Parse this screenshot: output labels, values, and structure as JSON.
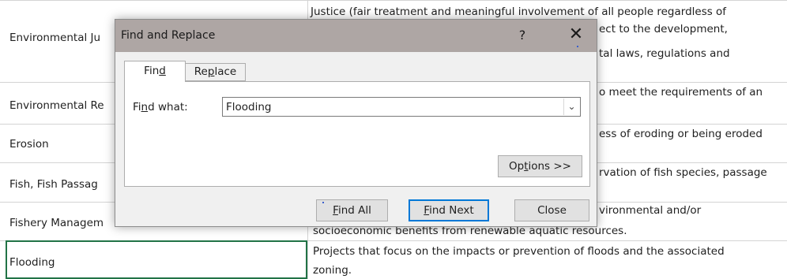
{
  "sheet": {
    "rows": [
      {
        "term": "Environmental Ju",
        "definition_lines": [
          "Justice (fair treatment and meaningful involvement of all people regardless of",
          "ect to the development,",
          "tal laws, regulations and"
        ]
      },
      {
        "term": "Environmental Re",
        "definition_lines": [
          "o meet the requirements of an"
        ]
      },
      {
        "term": "Erosion",
        "definition_lines": [
          "ess of eroding or being eroded"
        ]
      },
      {
        "term": "Fish, Fish Passag",
        "definition_lines": [
          "rvation of fish species, passage"
        ]
      },
      {
        "term": "Fishery Managem",
        "definition_lines": [
          "vironmental and/or",
          "socioeconomic benefits from renewable aquatic resources."
        ]
      },
      {
        "term": "Flooding",
        "definition_lines": [
          "Projects that focus on the impacts or prevention of floods and the associated",
          "zoning."
        ]
      }
    ],
    "accent_color": "#217346"
  },
  "dialog": {
    "title": "Find and Replace",
    "help_label": "?",
    "close_label": "✕",
    "tabs": {
      "find": "Find",
      "replace": "Replace"
    },
    "find_what_label": "Find what:",
    "find_value": "Flooding",
    "options_label": "Options >>",
    "find_all_label": "Find All",
    "find_next_label": "Find Next",
    "close_button_label": "Close",
    "titlebar_color": "#aea6a4",
    "focus_color": "#0078d7"
  }
}
